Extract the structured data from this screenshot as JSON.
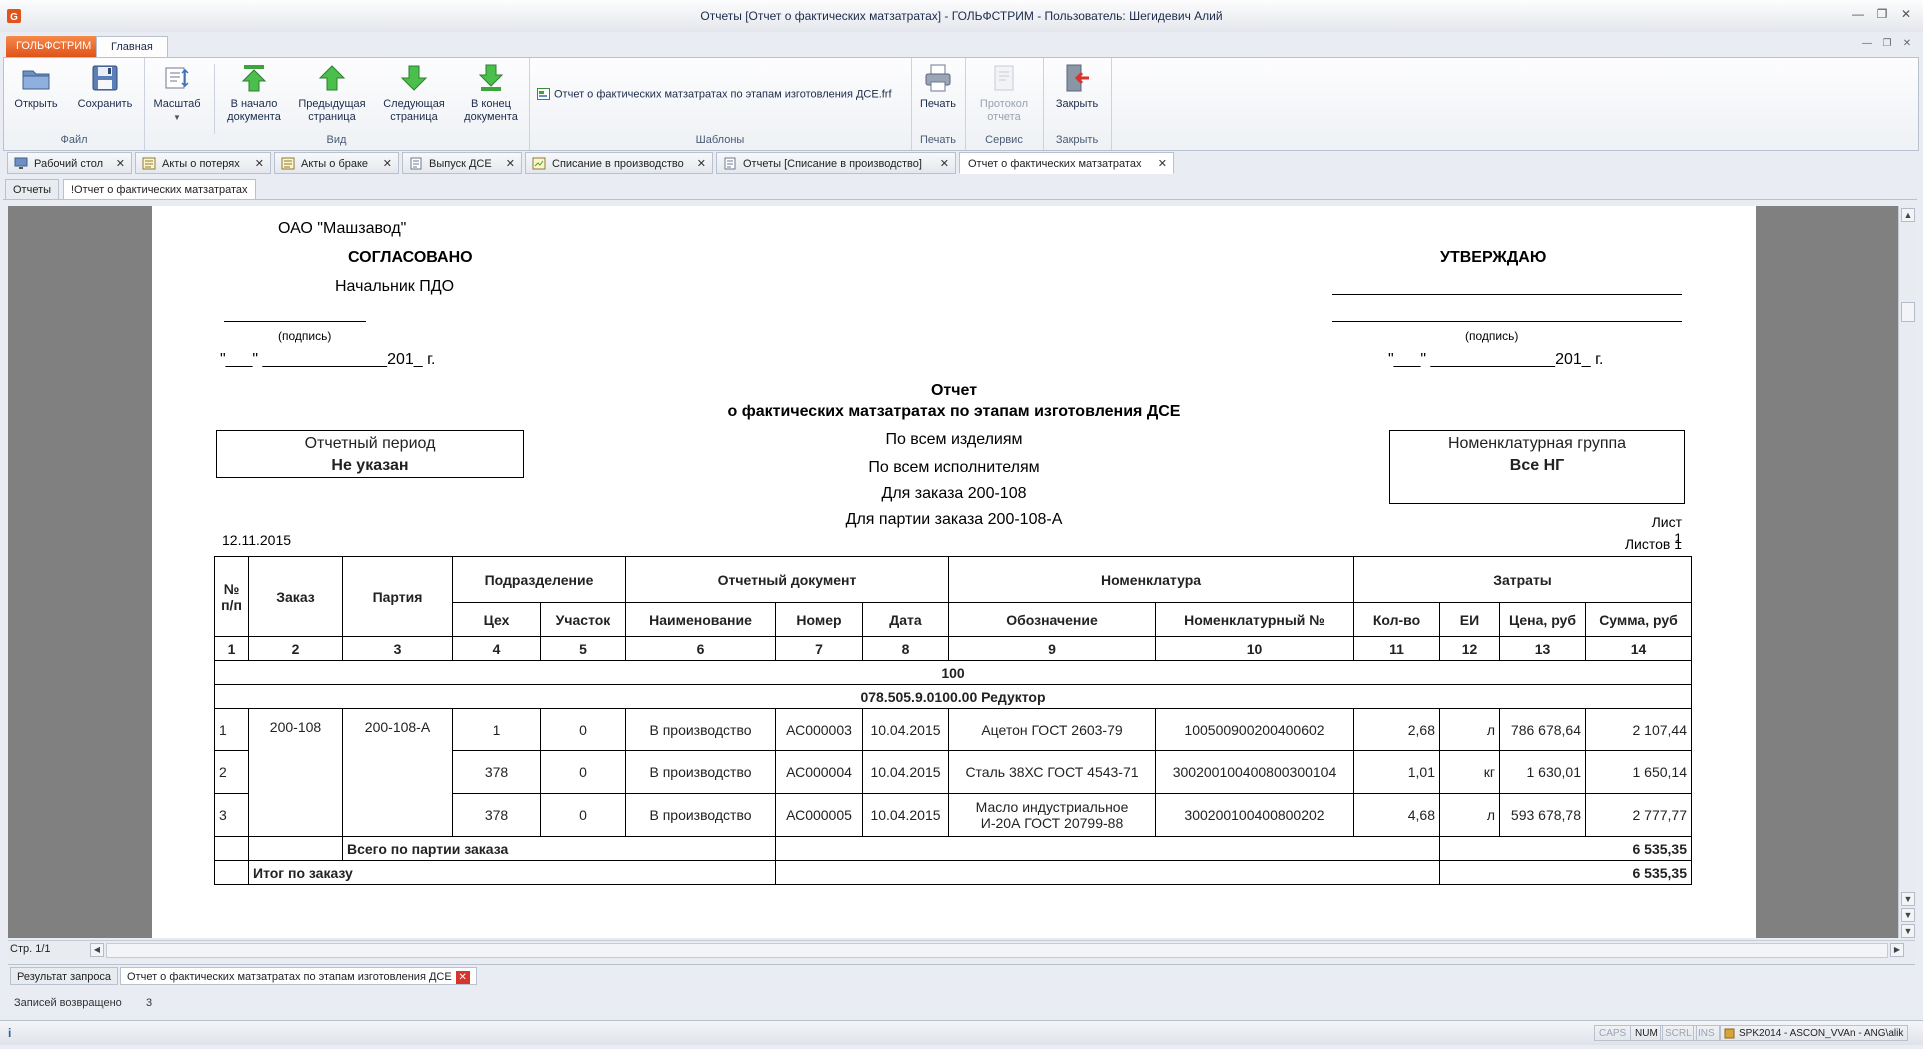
{
  "window": {
    "title": "Отчеты  [Отчет о фактических матзатратах] - ГОЛЬФСТРИМ - Пользователь: Шегидевич Алий"
  },
  "ribbon": {
    "app_tab": "ГОЛЬФСТРИМ",
    "home_tab": "Главная",
    "groups": {
      "file": "Файл",
      "view": "Вид",
      "templates": "Шаблоны",
      "print": "Печать",
      "service": "Сервис",
      "close": "Закрыть"
    },
    "buttons": {
      "open": "Открыть",
      "save": "Сохранить",
      "scale": "Масштаб",
      "first_page_1": "В начало",
      "first_page_2": "документа",
      "prev_page_1": "Предыдущая",
      "prev_page_2": "страница",
      "next_page_1": "Следующая",
      "next_page_2": "страница",
      "last_page_1": "В конец",
      "last_page_2": "документа",
      "template": "Отчет о фактических матзатратах по этапам изготовления ДСЕ.frf",
      "print": "Печать",
      "protocol_1": "Протокол",
      "protocol_2": "отчета",
      "close": "Закрыть"
    }
  },
  "doc_tabs": [
    {
      "label": "Рабочий стол"
    },
    {
      "label": "Акты о потерях"
    },
    {
      "label": "Акты о браке"
    },
    {
      "label": "Выпуск ДСЕ"
    },
    {
      "label": "Списание в производство"
    },
    {
      "label": "Отчеты  [Списание в производство]"
    },
    {
      "label": "Отчет о фактических матзатратах"
    }
  ],
  "sub_tabs": [
    {
      "label": "Отчеты"
    },
    {
      "label": "!Отчет о фактических матзатратах"
    }
  ],
  "report": {
    "org": "ОАО \"Машзавод\"",
    "agreed": "СОГЛАСОВАНО",
    "agreed_by": "Начальник ПДО",
    "approve": "УТВЕРЖДАЮ",
    "signature": "(подпись)",
    "date_line_left": "\"___\" ______________201_ г.",
    "date_line_right": "\"___\" ______________201_ г.",
    "title_1": "Отчет",
    "title_2": "о фактических матзатратах по этапам изготовления ДСЕ",
    "filter_products": "По всем изделиям",
    "filter_executors": "По всем исполнителям",
    "filter_order": "Для заказа 200-108",
    "filter_batch": "Для партии заказа 200-108-А",
    "period_label": "Отчетный период",
    "period_value": "Не указан",
    "nomgroup_label": "Номенклатурная группа",
    "nomgroup_value": "Все НГ",
    "date": "12.11.2015",
    "sheet": "Лист 1",
    "sheets": "Листов 1",
    "headers": {
      "num": "№ п/п",
      "order": "Заказ",
      "batch": "Партия",
      "division": "Подразделение",
      "workshop": "Цех",
      "section": "Участок",
      "report_doc": "Отчетный документ",
      "doc_name": "Наименование",
      "doc_number": "Номер",
      "doc_date": "Дата",
      "nomenclature": "Номенклатура",
      "designation": "Обозначение",
      "nom_number": "Номенклатурный №",
      "costs": "Затраты",
      "qty": "Кол-во",
      "unit": "ЕИ",
      "price": "Цена, руб",
      "sum": "Сумма, руб"
    },
    "col_numbers": [
      "1",
      "2",
      "3",
      "4",
      "5",
      "6",
      "7",
      "8",
      "9",
      "10",
      "11",
      "12",
      "13",
      "14"
    ],
    "group_1": "100",
    "group_2": "078.505.9.0100.00 Редуктор",
    "order_value": "200-108",
    "batch_value": "200-108-А",
    "rows": [
      {
        "n": "1",
        "workshop": "1",
        "section": "0",
        "doc_name": "В производство",
        "doc_number": "АС000003",
        "doc_date": "10.04.2015",
        "designation": "Ацетон ГОСТ 2603-79",
        "designation2": "",
        "nom": "100500900200400602",
        "qty": "2,68",
        "unit": "л",
        "price": "786 678,64",
        "sum": "2 107,44"
      },
      {
        "n": "2",
        "workshop": "378",
        "section": "0",
        "doc_name": "В производство",
        "doc_number": "АС000004",
        "doc_date": "10.04.2015",
        "designation": "Сталь 38ХС ГОСТ 4543-71",
        "designation2": "",
        "nom": "300200100400800300104",
        "qty": "1,01",
        "unit": "кг",
        "price": "1 630,01",
        "sum": "1 650,14"
      },
      {
        "n": "3",
        "workshop": "378",
        "section": "0",
        "doc_name": "В производство",
        "doc_number": "АС000005",
        "doc_date": "10.04.2015",
        "designation": "Масло индустриальное",
        "designation2": "И-20А ГОСТ 20799-88",
        "nom": "300200100400800202",
        "qty": "4,68",
        "unit": "л",
        "price": "593 678,78",
        "sum": "2 777,77"
      }
    ],
    "total_batch_label": "Всего по партии заказа",
    "total_batch_value": "6 535,35",
    "total_order_label": "Итог по заказу",
    "total_order_value": "6 535,35"
  },
  "viewer": {
    "page_indicator": "Стр. 1/1"
  },
  "bottom_tabs": [
    {
      "label": "Результат запроса"
    },
    {
      "label": "Отчет о фактических матзатратах по этапам изготовления ДСЕ"
    }
  ],
  "records": {
    "label": "Записей возвращено",
    "value": "3"
  },
  "status": {
    "caps": "CAPS",
    "num": "NUM",
    "scrl": "SCRL",
    "ins": "INS",
    "server": "SPK2014 - ASCON_VVAn - ANG\\alik"
  },
  "colors": {
    "accent": "#e0531a",
    "viewer_bg": "#808080",
    "arrow_green": "#3aa53a",
    "close_red": "#d9342b"
  }
}
